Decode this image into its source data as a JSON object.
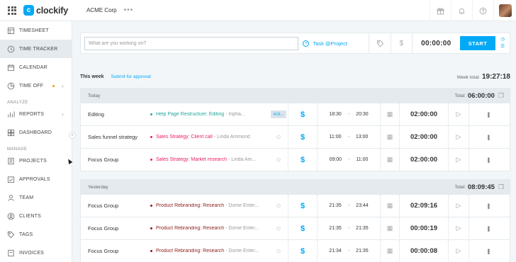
{
  "header": {
    "logo_mark": "c",
    "logo_text": "clockify",
    "workspace": "ACME Corp",
    "more": "•••",
    "icons": [
      "gift-icon",
      "bell-icon",
      "help-icon"
    ]
  },
  "sidebar": {
    "items": [
      {
        "label": "TIMESHEET",
        "icon": "timesheet-icon"
      },
      {
        "label": "TIME TRACKER",
        "icon": "clock-icon",
        "active": true
      },
      {
        "label": "CALENDAR",
        "icon": "calendar-icon"
      },
      {
        "label": "TIME OFF",
        "icon": "time-off-icon",
        "badge": true,
        "chevron": "›"
      }
    ],
    "analyze_heading": "ANALYZE",
    "analyze_items": [
      {
        "label": "REPORTS",
        "icon": "reports-icon",
        "chevron": "›"
      },
      {
        "label": "DASHBOARD",
        "icon": "dashboard-icon"
      }
    ],
    "manage_heading": "MANAGE",
    "manage_items": [
      {
        "label": "PROJECTS",
        "icon": "projects-icon"
      },
      {
        "label": "APPROVALS",
        "icon": "approvals-icon"
      },
      {
        "label": "TEAM",
        "icon": "team-icon"
      },
      {
        "label": "CLIENTS",
        "icon": "clients-icon"
      },
      {
        "label": "TAGS",
        "icon": "tags-icon"
      },
      {
        "label": "INVOICES",
        "icon": "invoices-icon"
      }
    ],
    "collapse": "«"
  },
  "timer": {
    "placeholder": "What are you working on?",
    "project_label": "Task @Project",
    "elapsed": "00:00:00",
    "start_label": "START"
  },
  "week": {
    "label": "This week",
    "submit_label": "Submit for approval",
    "total_label": "Week total:",
    "total": "19:27:18"
  },
  "days": [
    {
      "label": "Today",
      "total_label": "Total:",
      "total": "06:00:00",
      "entries": [
        {
          "description": "Editing",
          "project": "Help Page Restructure: Editing",
          "client": "- Inpha...",
          "color": "#26a69a",
          "tag": "#cli...",
          "start": "18:30",
          "end": "20:30",
          "duration": "02:00:00"
        },
        {
          "description": "Sales funnel strategy",
          "project": "Sales Strategy: Client call",
          "client": "- Linda Ammond",
          "color": "#e91e63",
          "tag": "",
          "start": "11:00",
          "end": "13:00",
          "duration": "02:00:00"
        },
        {
          "description": "Focus Group",
          "project": "Sales Strategy: Market research",
          "client": "- Linda Am...",
          "color": "#e91e63",
          "tag": "",
          "start": "09:00",
          "end": "11:00",
          "duration": "02:00:00"
        }
      ]
    },
    {
      "label": "Yesterday",
      "total_label": "Total:",
      "total": "08:09:45",
      "entries": [
        {
          "description": "Focus Group",
          "project": "Product Rebranding: Research",
          "client": "- Dome Enter...",
          "color": "#8d1c1c",
          "tag": "",
          "start": "21:35",
          "end": "23:44",
          "duration": "02:09:16"
        },
        {
          "description": "Focus Group",
          "project": "Product Rebranding: Research",
          "client": "- Dome Enter...",
          "color": "#8d1c1c",
          "tag": "",
          "start": "21:35",
          "end": "21:35",
          "duration": "00:00:19"
        },
        {
          "description": "Focus Group",
          "project": "Product Rebranding: Research",
          "client": "- Dome Enter...",
          "color": "#8d1c1c",
          "tag": "",
          "start": "21:34",
          "end": "21:35",
          "duration": "00:00:08"
        }
      ]
    }
  ],
  "colors": {
    "accent": "#03a9f4"
  }
}
